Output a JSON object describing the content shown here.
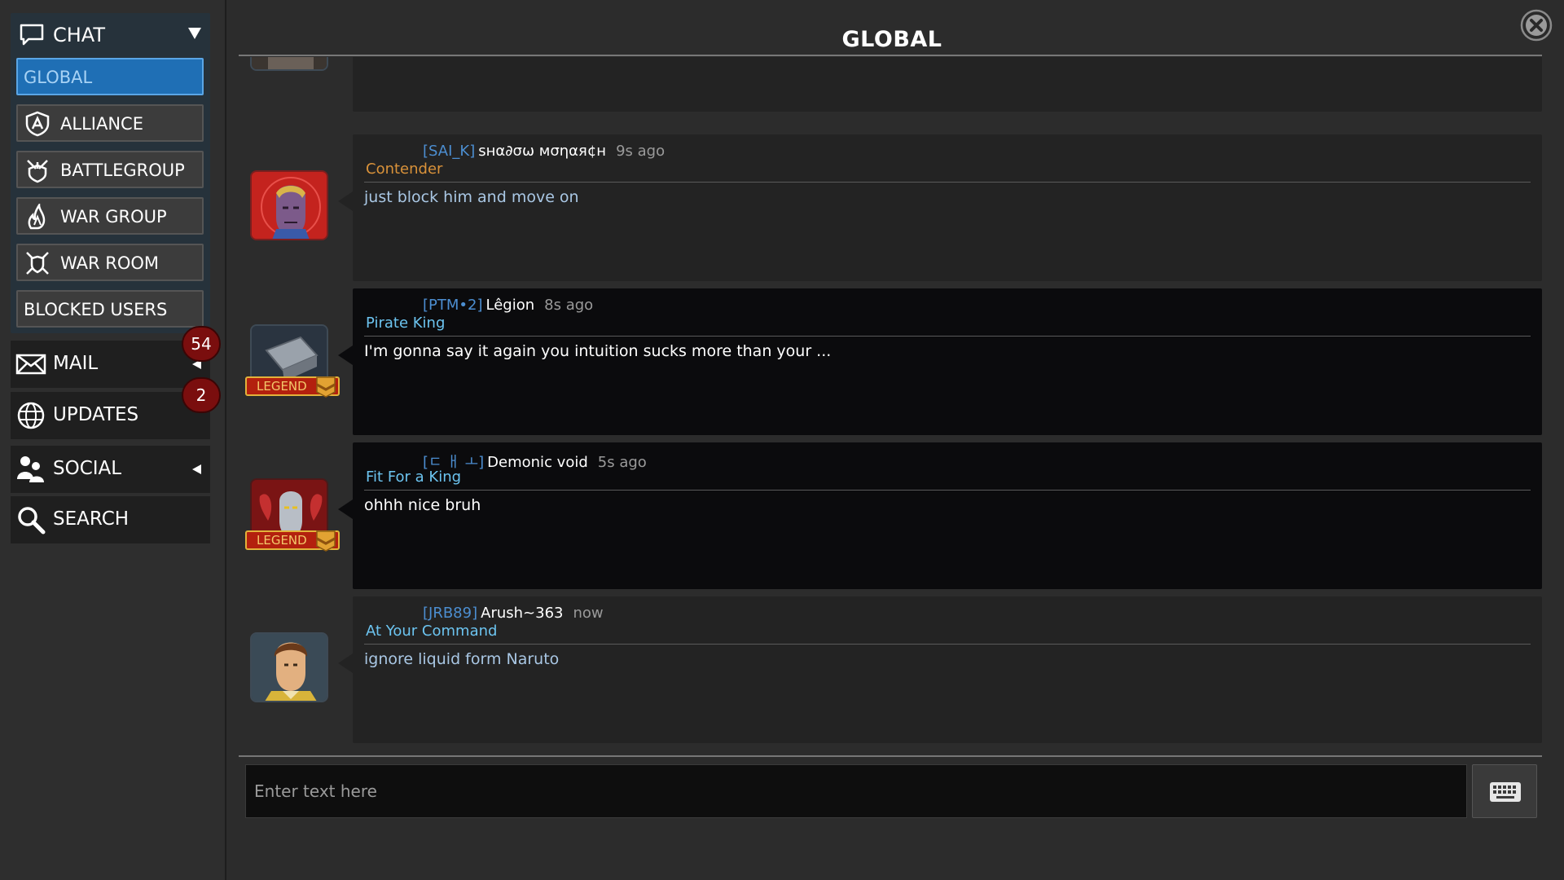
{
  "sidebar": {
    "chat": {
      "label": "CHAT",
      "channels": [
        {
          "label": "GLOBAL",
          "active": true,
          "icon": ""
        },
        {
          "label": "ALLIANCE",
          "active": false,
          "icon": "alliance-shield-icon"
        },
        {
          "label": "BATTLEGROUP",
          "active": false,
          "icon": "battlegroup-icon"
        },
        {
          "label": "WAR GROUP",
          "active": false,
          "icon": "war-group-icon"
        },
        {
          "label": "WAR ROOM",
          "active": false,
          "icon": "war-room-icon"
        },
        {
          "label": "BLOCKED USERS",
          "active": false,
          "icon": ""
        }
      ]
    },
    "mail": {
      "label": "MAIL",
      "badge": "54"
    },
    "updates": {
      "label": "UPDATES",
      "badge": "2"
    },
    "social": {
      "label": "SOCIAL"
    },
    "search": {
      "label": "SEARCH"
    }
  },
  "header": {
    "title": "GLOBAL"
  },
  "messages": [
    {
      "tag": "[SAI_K]",
      "name": "ѕнα∂σω мσηαя¢н",
      "time": "9s ago",
      "rank": "Contender",
      "rank_color": "#d9923a",
      "text": "just block him and move on",
      "text_color": "#a9c7e4",
      "avatar": "thanos-avatar",
      "legend": false,
      "dark": false
    },
    {
      "tag": "[PTM•2]",
      "name": "Lêgion",
      "time": "8s ago",
      "rank": "Pirate King",
      "rank_color": "#6cc4f0",
      "text": "I'm gonna say it again you intuition sucks more than your ...",
      "text_color": "#ffffff",
      "avatar": "hammer-avatar",
      "legend": true,
      "legend_label": "LEGEND",
      "dark": true
    },
    {
      "tag": "[ㄷ ㅐ ㅗ]",
      "name": "Demonic void",
      "time": "5s ago",
      "rank": "Fit For a King",
      "rank_color": "#6cc4f0",
      "text": "ohhh nice bruh",
      "text_color": "#ffffff",
      "avatar": "ultron-avatar",
      "legend": true,
      "legend_label": "LEGEND",
      "dark": true
    },
    {
      "tag": "[JRB89]",
      "name": "Arush~363",
      "time": "now",
      "rank": "At Your Command",
      "rank_color": "#6cc4f0",
      "text": "ignore liquid form Naruto",
      "text_color": "#a9c7e4",
      "avatar": "hyperion-avatar",
      "legend": false,
      "dark": false
    }
  ],
  "input": {
    "placeholder": "Enter text here"
  }
}
